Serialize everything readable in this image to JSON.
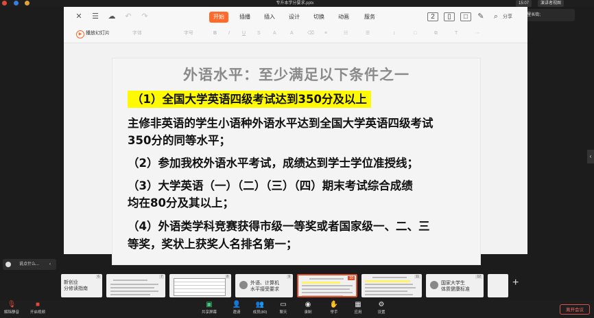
{
  "window": {
    "file_title": "专升本学分要求.pptx",
    "clock": "15:07",
    "view_mode": "演讲者视图",
    "speaking": "正在讲话: 半里长街;"
  },
  "toolbar": {
    "menus": [
      "开始",
      "插播",
      "插入",
      "设计",
      "切换",
      "动画",
      "服务"
    ],
    "play_label": "播放幻灯片",
    "font_name": "字体",
    "font_size": "字号",
    "right_label": "分享"
  },
  "slide": {
    "title": "外语水平：至少满足以下条件之一",
    "lines": [
      "（1）全国大学英语四级考试达到350分及以上",
      "主修非英语的学生小语种外语水平达到全国大学英语四级考试",
      "350分的同等水平；",
      "（2）参加我校外语水平考试，成绩达到学士学位准授线；",
      "（3）大学英语（一）（二）（三）（四）期末考试综合成绩",
      "均在80分及其以上；",
      "（4）外语类学科竞赛获得市级一等奖或者国家级一、二、三",
      "等奖，奖状上获奖人名排名第一；"
    ]
  },
  "filmstrip": {
    "thumbs": [
      {
        "num": "6",
        "text": "新创业\n分修读指南"
      },
      {
        "num": "7",
        "text": ""
      },
      {
        "num": "8",
        "text": ""
      },
      {
        "num": "9",
        "text": "外语、计算机\n水平接受要求"
      },
      {
        "num": "10",
        "text": ""
      },
      {
        "num": "11",
        "text": ""
      },
      {
        "num": "12",
        "text": "国家大学生\n体质健康标准"
      }
    ],
    "add": "+"
  },
  "chat": {
    "placeholder": "说点什么..."
  },
  "controls": {
    "mute": "解除静音",
    "video": "开启视频",
    "share": "共享屏幕",
    "invite": "邀请",
    "members": "成员(80)",
    "chat": "聊天",
    "record": "录制",
    "raise": "举手",
    "apps": "应用",
    "settings": "设置",
    "leave": "离开会议"
  }
}
